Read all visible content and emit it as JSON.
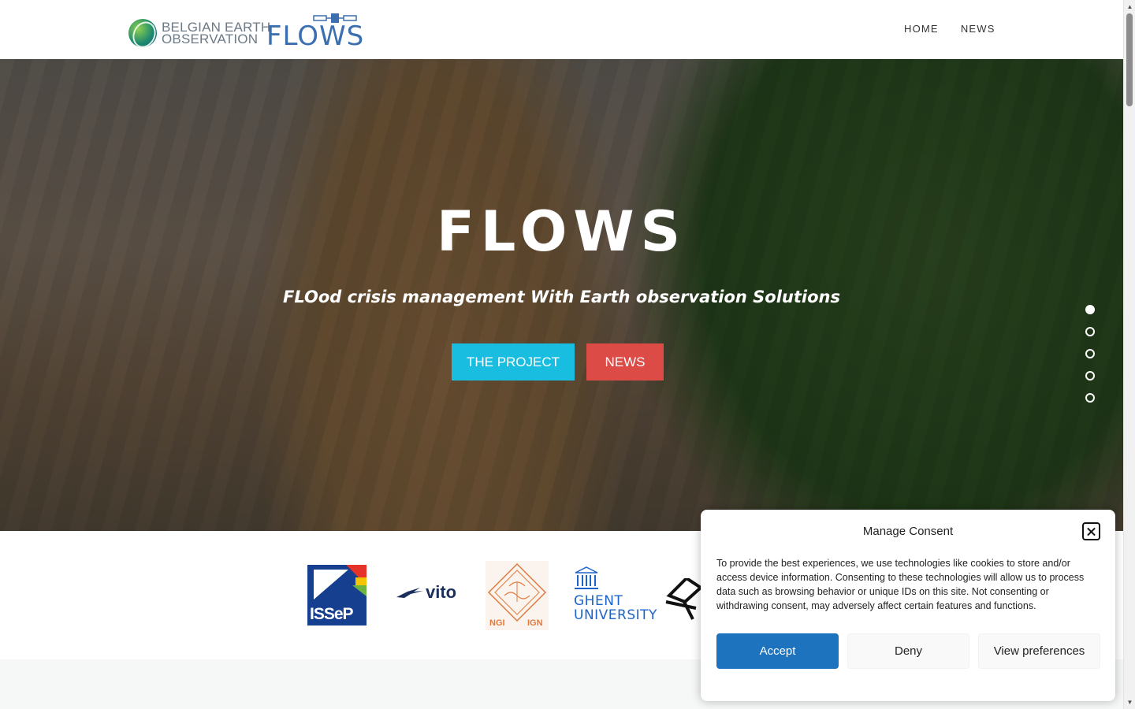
{
  "header": {
    "logo_beo": {
      "line1": "BELGIAN EARTH",
      "line2": "OBSERVATION"
    },
    "logo_flows": "FLOWS",
    "nav": [
      {
        "label": "HOME"
      },
      {
        "label": "NEWS"
      }
    ]
  },
  "hero": {
    "title": "FLOWS",
    "subtitle": "FLOod crisis management With Earth observation Solutions",
    "buttons": {
      "project": "THE PROJECT",
      "news": "NEWS"
    },
    "slides": {
      "count": 5,
      "active_index": 0
    }
  },
  "partners": {
    "issep": "ISSeP",
    "vito": "vito",
    "ngi_left": "NGI",
    "ngi_right": "IGN",
    "ugent_line1": "GHENT",
    "ugent_line2": "UNIVERSITY"
  },
  "consent": {
    "title": "Manage Consent",
    "body": "To provide the best experiences, we use technologies like cookies to store and/or access device information. Consenting to these technologies will allow us to process data such as browsing behavior or unique IDs on this site. Not consenting or withdrawing consent, may adversely affect certain features and functions.",
    "accept": "Accept",
    "deny": "Deny",
    "preferences": "View preferences"
  },
  "colors": {
    "project_button": "#19bde0",
    "news_button": "#dd4b47",
    "accept_button": "#1e73be",
    "flows_logo": "#3b6fb0"
  }
}
